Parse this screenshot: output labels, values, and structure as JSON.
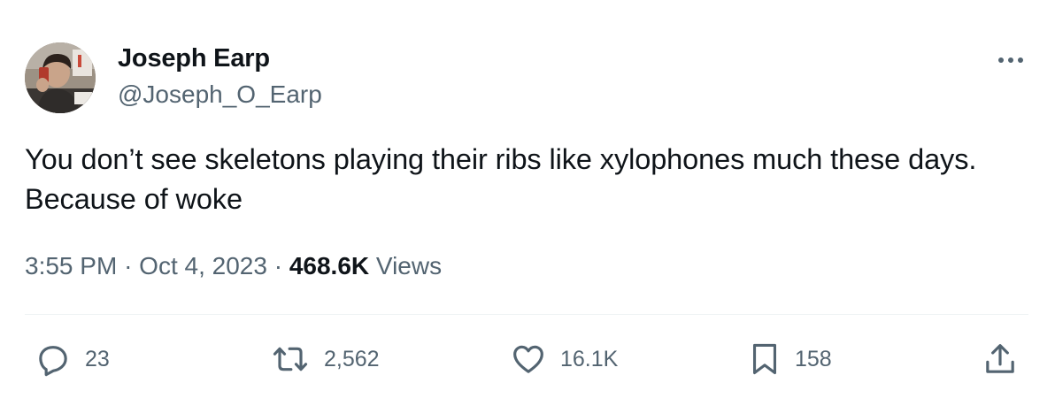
{
  "author": {
    "display_name": "Joseph Earp",
    "handle": "@Joseph_O_Earp",
    "avatar_icon": "profile-photo"
  },
  "tweet": {
    "text": "You don’t see skeletons playing their ribs like xylophones much these days. Because of woke"
  },
  "meta": {
    "time": "3:55 PM",
    "separator": "·",
    "date": "Oct 4, 2023",
    "views_count": "468.6K",
    "views_label": "Views"
  },
  "actions": {
    "replies": "23",
    "retweets": "2,562",
    "likes": "16.1K",
    "bookmarks": "158"
  },
  "colors": {
    "text_primary": "#0f1419",
    "text_secondary": "#536471",
    "divider": "#eff3f4"
  }
}
